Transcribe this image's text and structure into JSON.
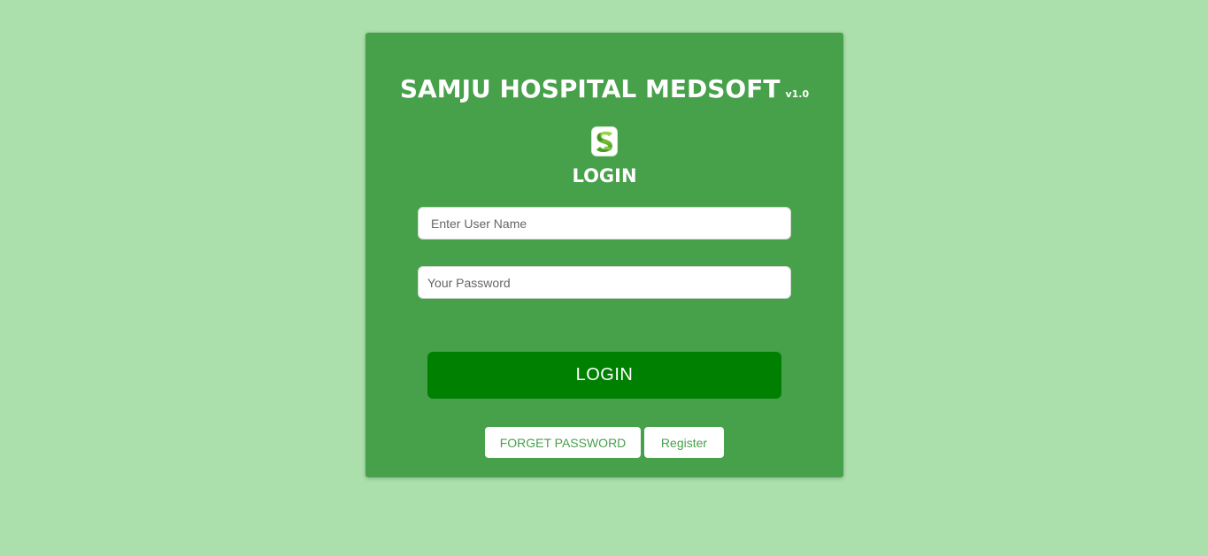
{
  "header": {
    "title": "SAMJU HOSPITAL MEDSOFT",
    "version": "v1.0",
    "logo_icon": "leaf-s-logo-icon"
  },
  "form": {
    "heading": "LOGIN",
    "username_placeholder": "Enter User Name",
    "username_value": "",
    "password_placeholder": "Your Password",
    "password_value": "",
    "login_label": "LOGIN",
    "forget_label": "FORGET PASSWORD",
    "register_label": "Register"
  },
  "colors": {
    "background": "#abdfab",
    "card": "#46a14a",
    "login_button": "#008000",
    "link_text": "#46a14a"
  }
}
